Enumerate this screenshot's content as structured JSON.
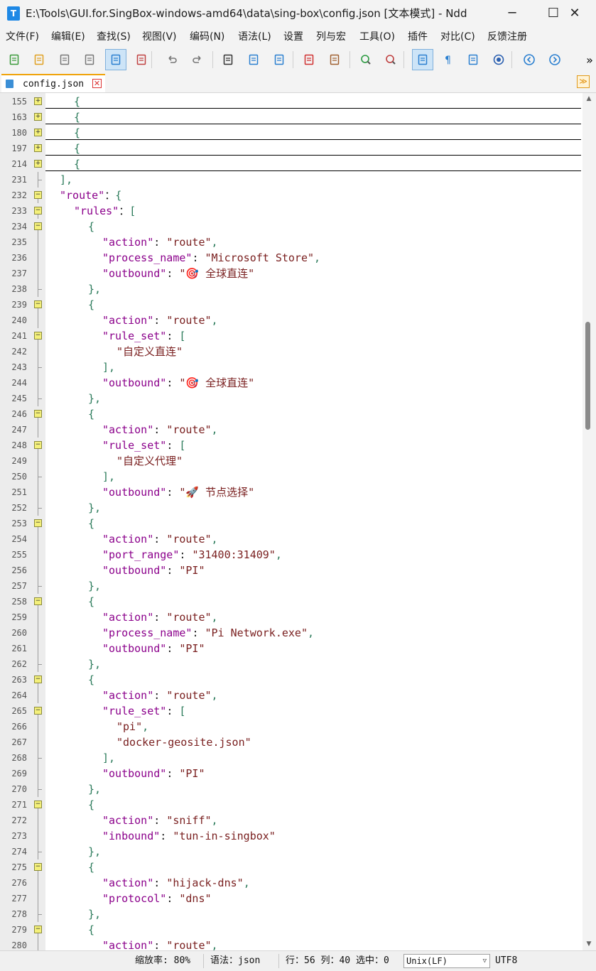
{
  "window": {
    "title": "E:\\Tools\\GUI.for.SingBox-windows-amd64\\data\\sing-box\\config.json [文本模式] - Ndd",
    "minimize": "─",
    "maximize": "☐",
    "close": "✕"
  },
  "menu": [
    "文件(F)",
    "编辑(E)",
    "查找(S)",
    "视图(V)",
    "编码(N)",
    "语法(L)",
    "设置",
    "列与宏",
    "工具(O)",
    "插件",
    "对比(C)",
    "反馈注册"
  ],
  "toolbar": {
    "more": "»",
    "icons": [
      "new-file-icon",
      "open-file-icon",
      "save-icon",
      "save-all-icon",
      "text-mode-icon",
      "close-file-icon",
      "undo-icon",
      "redo-icon",
      "find-icon",
      "replace-icon",
      "bookmark-icon",
      "mark-icon",
      "clear-mark-icon",
      "zoom-in-icon",
      "zoom-out-icon",
      "word-wrap-icon",
      "show-symbols-icon",
      "indent-guide-icon",
      "function-list-icon",
      "previous-icon",
      "next-icon"
    ]
  },
  "tab": {
    "label": "config.json",
    "close": "✕"
  },
  "tab_dropdown": "≫",
  "editor": {
    "lines": [
      {
        "n": "155",
        "fold": "plus",
        "tokens": [
          [
            "p",
            "{"
          ]
        ],
        "indent": 1
      },
      {
        "n": "163",
        "fold": "plus",
        "tokens": [
          [
            "p",
            "{"
          ]
        ],
        "indent": 1
      },
      {
        "n": "180",
        "fold": "plus",
        "tokens": [
          [
            "p",
            "{"
          ]
        ],
        "indent": 1
      },
      {
        "n": "197",
        "fold": "plus",
        "tokens": [
          [
            "p",
            "{"
          ]
        ],
        "indent": 1
      },
      {
        "n": "214",
        "fold": "plus",
        "tokens": [
          [
            "p",
            "{"
          ]
        ],
        "indent": 1
      },
      {
        "n": "231",
        "fold": "tick",
        "tokens": [
          [
            "p",
            "],"
          ]
        ],
        "indent": 0
      },
      {
        "n": "232",
        "fold": "minus",
        "tokens": [
          [
            "k",
            "\"route\""
          ],
          [
            "",
            "："
          ],
          [
            "p",
            "{"
          ]
        ],
        "indent": 0
      },
      {
        "n": "233",
        "fold": "minus",
        "tokens": [
          [
            "k",
            "\"rules\""
          ],
          [
            "",
            "："
          ],
          [
            "p",
            "["
          ]
        ],
        "indent": 1
      },
      {
        "n": "234",
        "fold": "minus",
        "tokens": [
          [
            "p",
            "{"
          ]
        ],
        "indent": 2
      },
      {
        "n": "235",
        "fold": "line",
        "tokens": [
          [
            "k",
            "\"action\""
          ],
          [
            "",
            ": "
          ],
          [
            "s",
            "\"route\""
          ],
          [
            "p",
            ","
          ]
        ],
        "indent": 3
      },
      {
        "n": "236",
        "fold": "line",
        "tokens": [
          [
            "k",
            "\"process_name\""
          ],
          [
            "",
            ": "
          ],
          [
            "s",
            "\"Microsoft Store\""
          ],
          [
            "p",
            ","
          ]
        ],
        "indent": 3
      },
      {
        "n": "237",
        "fold": "line",
        "tokens": [
          [
            "k",
            "\"outbound\""
          ],
          [
            "",
            ": "
          ],
          [
            "s",
            "\"🎯 全球直连\""
          ]
        ],
        "indent": 3
      },
      {
        "n": "238",
        "fold": "tick",
        "tokens": [
          [
            "p",
            "},"
          ]
        ],
        "indent": 2
      },
      {
        "n": "239",
        "fold": "minus",
        "tokens": [
          [
            "p",
            "{"
          ]
        ],
        "indent": 2
      },
      {
        "n": "240",
        "fold": "line",
        "tokens": [
          [
            "k",
            "\"action\""
          ],
          [
            "",
            ": "
          ],
          [
            "s",
            "\"route\""
          ],
          [
            "p",
            ","
          ]
        ],
        "indent": 3
      },
      {
        "n": "241",
        "fold": "minus",
        "tokens": [
          [
            "k",
            "\"rule_set\""
          ],
          [
            "",
            ": "
          ],
          [
            "p",
            "["
          ]
        ],
        "indent": 3
      },
      {
        "n": "242",
        "fold": "line",
        "tokens": [
          [
            "s",
            "\"自定义直连\""
          ]
        ],
        "indent": 4
      },
      {
        "n": "243",
        "fold": "tick",
        "tokens": [
          [
            "p",
            "],"
          ]
        ],
        "indent": 3
      },
      {
        "n": "244",
        "fold": "line",
        "tokens": [
          [
            "k",
            "\"outbound\""
          ],
          [
            "",
            ": "
          ],
          [
            "s",
            "\"🎯 全球直连\""
          ]
        ],
        "indent": 3
      },
      {
        "n": "245",
        "fold": "tick",
        "tokens": [
          [
            "p",
            "},"
          ]
        ],
        "indent": 2
      },
      {
        "n": "246",
        "fold": "minus",
        "tokens": [
          [
            "p",
            "{"
          ]
        ],
        "indent": 2
      },
      {
        "n": "247",
        "fold": "line",
        "tokens": [
          [
            "k",
            "\"action\""
          ],
          [
            "",
            ": "
          ],
          [
            "s",
            "\"route\""
          ],
          [
            "p",
            ","
          ]
        ],
        "indent": 3
      },
      {
        "n": "248",
        "fold": "minus",
        "tokens": [
          [
            "k",
            "\"rule_set\""
          ],
          [
            "",
            ": "
          ],
          [
            "p",
            "["
          ]
        ],
        "indent": 3
      },
      {
        "n": "249",
        "fold": "line",
        "tokens": [
          [
            "s",
            "\"自定义代理\""
          ]
        ],
        "indent": 4
      },
      {
        "n": "250",
        "fold": "tick",
        "tokens": [
          [
            "p",
            "],"
          ]
        ],
        "indent": 3
      },
      {
        "n": "251",
        "fold": "line",
        "tokens": [
          [
            "k",
            "\"outbound\""
          ],
          [
            "",
            ": "
          ],
          [
            "s",
            "\"🚀 节点选择\""
          ]
        ],
        "indent": 3
      },
      {
        "n": "252",
        "fold": "tick",
        "tokens": [
          [
            "p",
            "},"
          ]
        ],
        "indent": 2
      },
      {
        "n": "253",
        "fold": "minus",
        "tokens": [
          [
            "p",
            "{"
          ]
        ],
        "indent": 2
      },
      {
        "n": "254",
        "fold": "line",
        "tokens": [
          [
            "k",
            "\"action\""
          ],
          [
            "",
            ": "
          ],
          [
            "s",
            "\"route\""
          ],
          [
            "p",
            ","
          ]
        ],
        "indent": 3
      },
      {
        "n": "255",
        "fold": "line",
        "tokens": [
          [
            "k",
            "\"port_range\""
          ],
          [
            "",
            ": "
          ],
          [
            "s",
            "\"31400:31409\""
          ],
          [
            "p",
            ","
          ]
        ],
        "indent": 3
      },
      {
        "n": "256",
        "fold": "line",
        "tokens": [
          [
            "k",
            "\"outbound\""
          ],
          [
            "",
            ": "
          ],
          [
            "s",
            "\"PI\""
          ]
        ],
        "indent": 3
      },
      {
        "n": "257",
        "fold": "tick",
        "tokens": [
          [
            "p",
            "},"
          ]
        ],
        "indent": 2
      },
      {
        "n": "258",
        "fold": "minus",
        "tokens": [
          [
            "p",
            "{"
          ]
        ],
        "indent": 2
      },
      {
        "n": "259",
        "fold": "line",
        "tokens": [
          [
            "k",
            "\"action\""
          ],
          [
            "",
            ": "
          ],
          [
            "s",
            "\"route\""
          ],
          [
            "p",
            ","
          ]
        ],
        "indent": 3
      },
      {
        "n": "260",
        "fold": "line",
        "tokens": [
          [
            "k",
            "\"process_name\""
          ],
          [
            "",
            ": "
          ],
          [
            "s",
            "\"Pi Network.exe\""
          ],
          [
            "p",
            ","
          ]
        ],
        "indent": 3
      },
      {
        "n": "261",
        "fold": "line",
        "tokens": [
          [
            "k",
            "\"outbound\""
          ],
          [
            "",
            ": "
          ],
          [
            "s",
            "\"PI\""
          ]
        ],
        "indent": 3
      },
      {
        "n": "262",
        "fold": "tick",
        "tokens": [
          [
            "p",
            "},"
          ]
        ],
        "indent": 2
      },
      {
        "n": "263",
        "fold": "minus",
        "tokens": [
          [
            "p",
            "{"
          ]
        ],
        "indent": 2
      },
      {
        "n": "264",
        "fold": "line",
        "tokens": [
          [
            "k",
            "\"action\""
          ],
          [
            "",
            ": "
          ],
          [
            "s",
            "\"route\""
          ],
          [
            "p",
            ","
          ]
        ],
        "indent": 3
      },
      {
        "n": "265",
        "fold": "minus",
        "tokens": [
          [
            "k",
            "\"rule_set\""
          ],
          [
            "",
            ": "
          ],
          [
            "p",
            "["
          ]
        ],
        "indent": 3
      },
      {
        "n": "266",
        "fold": "line",
        "tokens": [
          [
            "s",
            "\"pi\""
          ],
          [
            "p",
            ","
          ]
        ],
        "indent": 4
      },
      {
        "n": "267",
        "fold": "line",
        "tokens": [
          [
            "s",
            "\"docker-geosite.json\""
          ]
        ],
        "indent": 4
      },
      {
        "n": "268",
        "fold": "tick",
        "tokens": [
          [
            "p",
            "],"
          ]
        ],
        "indent": 3
      },
      {
        "n": "269",
        "fold": "line",
        "tokens": [
          [
            "k",
            "\"outbound\""
          ],
          [
            "",
            ": "
          ],
          [
            "s",
            "\"PI\""
          ]
        ],
        "indent": 3
      },
      {
        "n": "270",
        "fold": "tick",
        "tokens": [
          [
            "p",
            "},"
          ]
        ],
        "indent": 2
      },
      {
        "n": "271",
        "fold": "minus",
        "tokens": [
          [
            "p",
            "{"
          ]
        ],
        "indent": 2
      },
      {
        "n": "272",
        "fold": "line",
        "tokens": [
          [
            "k",
            "\"action\""
          ],
          [
            "",
            ": "
          ],
          [
            "s",
            "\"sniff\""
          ],
          [
            "p",
            ","
          ]
        ],
        "indent": 3
      },
      {
        "n": "273",
        "fold": "line",
        "tokens": [
          [
            "k",
            "\"inbound\""
          ],
          [
            "",
            ": "
          ],
          [
            "s",
            "\"tun-in-singbox\""
          ]
        ],
        "indent": 3
      },
      {
        "n": "274",
        "fold": "tick",
        "tokens": [
          [
            "p",
            "},"
          ]
        ],
        "indent": 2
      },
      {
        "n": "275",
        "fold": "minus",
        "tokens": [
          [
            "p",
            "{"
          ]
        ],
        "indent": 2
      },
      {
        "n": "276",
        "fold": "line",
        "tokens": [
          [
            "k",
            "\"action\""
          ],
          [
            "",
            ": "
          ],
          [
            "s",
            "\"hijack-dns\""
          ],
          [
            "p",
            ","
          ]
        ],
        "indent": 3
      },
      {
        "n": "277",
        "fold": "line",
        "tokens": [
          [
            "k",
            "\"protocol\""
          ],
          [
            "",
            ": "
          ],
          [
            "s",
            "\"dns\""
          ]
        ],
        "indent": 3
      },
      {
        "n": "278",
        "fold": "tick",
        "tokens": [
          [
            "p",
            "},"
          ]
        ],
        "indent": 2
      },
      {
        "n": "279",
        "fold": "minus",
        "tokens": [
          [
            "p",
            "{"
          ]
        ],
        "indent": 2
      },
      {
        "n": "280",
        "fold": "line",
        "tokens": [
          [
            "k",
            "\"action\""
          ],
          [
            "",
            ": "
          ],
          [
            "s",
            "\"route\""
          ],
          [
            "p",
            ","
          ]
        ],
        "indent": 3
      }
    ]
  },
  "status": {
    "zoom": "缩放率: 80%",
    "syntax": "语法：json",
    "position": "行：56 列：40 选中：0",
    "eol": "Unix(LF)",
    "eol_arrow": "▽",
    "encoding": "UTF8"
  },
  "colors": {
    "key": "#8b008b",
    "string": "#7a2020",
    "punct": "#2a7a5a",
    "tab_accent": "#f0a30a",
    "fold_box": "#f4f07a"
  }
}
